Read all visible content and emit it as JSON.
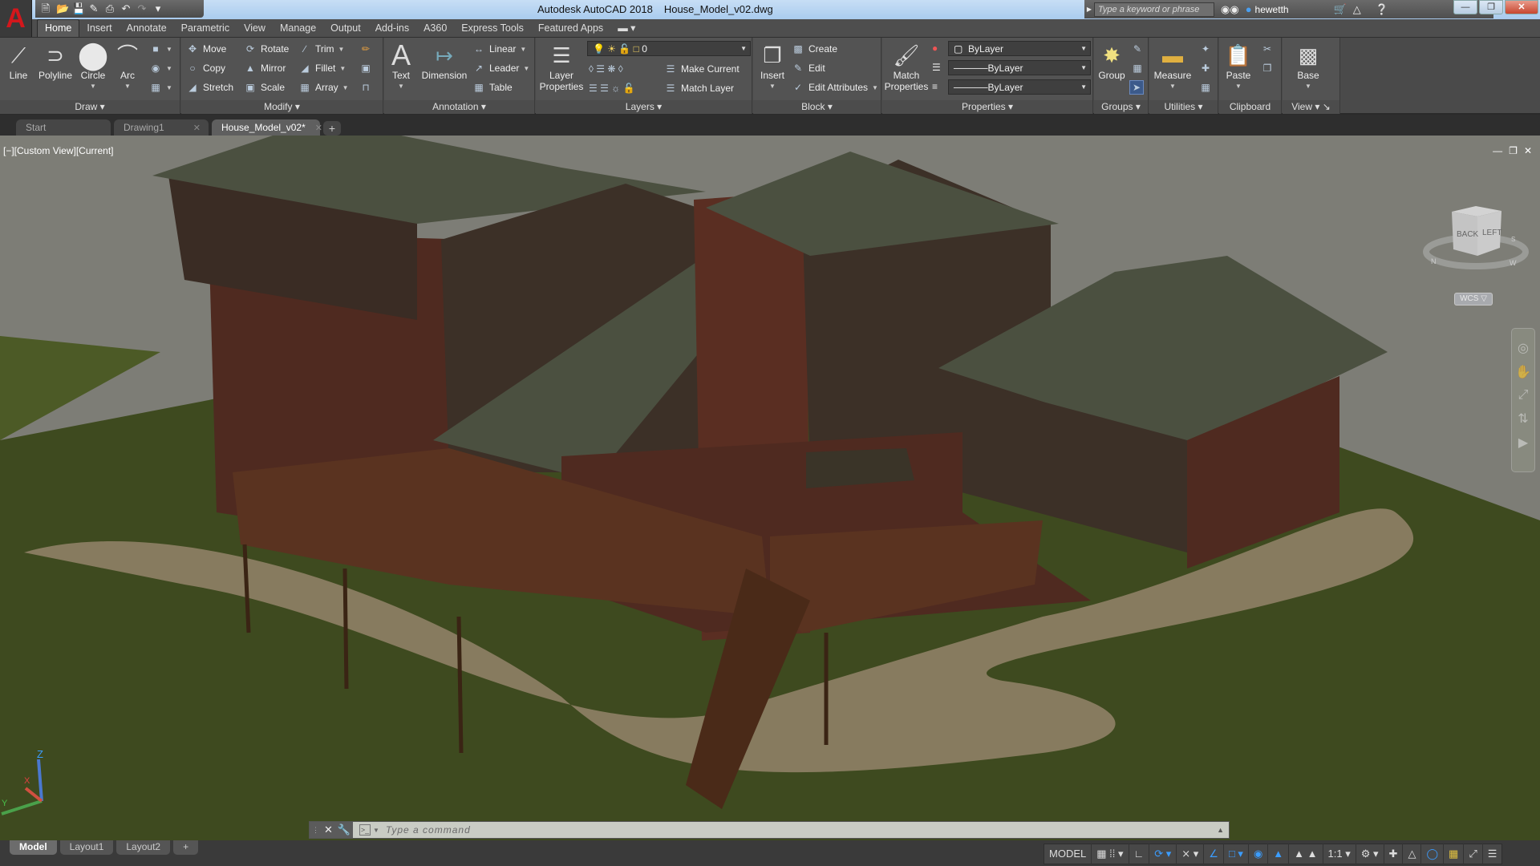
{
  "titlebar": {
    "app_name": "Autodesk AutoCAD 2018",
    "file_name": "House_Model_v02.dwg",
    "app_logo": "A",
    "search_placeholder": "Type a keyword or phrase",
    "user": "hewetth"
  },
  "qat": [
    "new-icon",
    "open-icon",
    "save-icon",
    "save-as-icon",
    "plot-icon",
    "undo-icon",
    "redo-icon",
    "customize-icon"
  ],
  "ribbon_tabs": [
    "Home",
    "Insert",
    "Annotate",
    "Parametric",
    "View",
    "Manage",
    "Output",
    "Add-ins",
    "A360",
    "Express Tools",
    "Featured Apps"
  ],
  "active_tab": "Home",
  "panels": {
    "draw": {
      "title": "Draw",
      "line": "Line",
      "polyline": "Polyline",
      "circle": "Circle",
      "arc": "Arc"
    },
    "modify": {
      "title": "Modify",
      "move": "Move",
      "rotate": "Rotate",
      "trim": "Trim",
      "copy": "Copy",
      "mirror": "Mirror",
      "fillet": "Fillet",
      "stretch": "Stretch",
      "scale": "Scale",
      "array": "Array"
    },
    "annotation": {
      "title": "Annotation",
      "text": "Text",
      "dimension": "Dimension",
      "linear": "Linear",
      "leader": "Leader",
      "table": "Table"
    },
    "layers": {
      "title": "Layers",
      "layer_properties": "Layer Properties",
      "current_layer": "0",
      "make_current": "Make Current",
      "match_layer": "Match Layer"
    },
    "block": {
      "title": "Block",
      "insert": "Insert",
      "create": "Create",
      "edit": "Edit",
      "edit_attributes": "Edit Attributes"
    },
    "properties": {
      "title": "Properties",
      "match_properties": "Match Properties",
      "color": "ByLayer",
      "linetype": "ByLayer",
      "lineweight": "ByLayer"
    },
    "groups": {
      "title": "Groups",
      "group": "Group"
    },
    "utilities": {
      "title": "Utilities",
      "measure": "Measure"
    },
    "clipboard": {
      "title": "Clipboard",
      "paste": "Paste"
    },
    "view": {
      "title": "View",
      "base": "Base"
    }
  },
  "file_tabs": [
    {
      "label": "Start",
      "closable": false,
      "active": false
    },
    {
      "label": "Drawing1",
      "closable": true,
      "active": false
    },
    {
      "label": "House_Model_v02*",
      "closable": true,
      "active": true
    }
  ],
  "viewport": {
    "label": "[−][Custom View][Current]",
    "viewcube": {
      "face_left": "BACK",
      "face_right": "LEFT",
      "compass": [
        "N",
        "W",
        "S"
      ]
    },
    "wcs": "WCS ▽",
    "ucs": {
      "x": "X",
      "y": "Y",
      "z": "Z"
    }
  },
  "command_line": {
    "placeholder": "Type a command"
  },
  "layout_tabs": [
    {
      "label": "Model",
      "active": true
    },
    {
      "label": "Layout1",
      "active": false
    },
    {
      "label": "Layout2",
      "active": false
    }
  ],
  "status": {
    "model": "MODEL",
    "scale": "1:1"
  },
  "colors": {
    "accent_blue": "#3b9dff",
    "logo_red": "#d3171c",
    "titlebar": "#b6d3f0"
  }
}
